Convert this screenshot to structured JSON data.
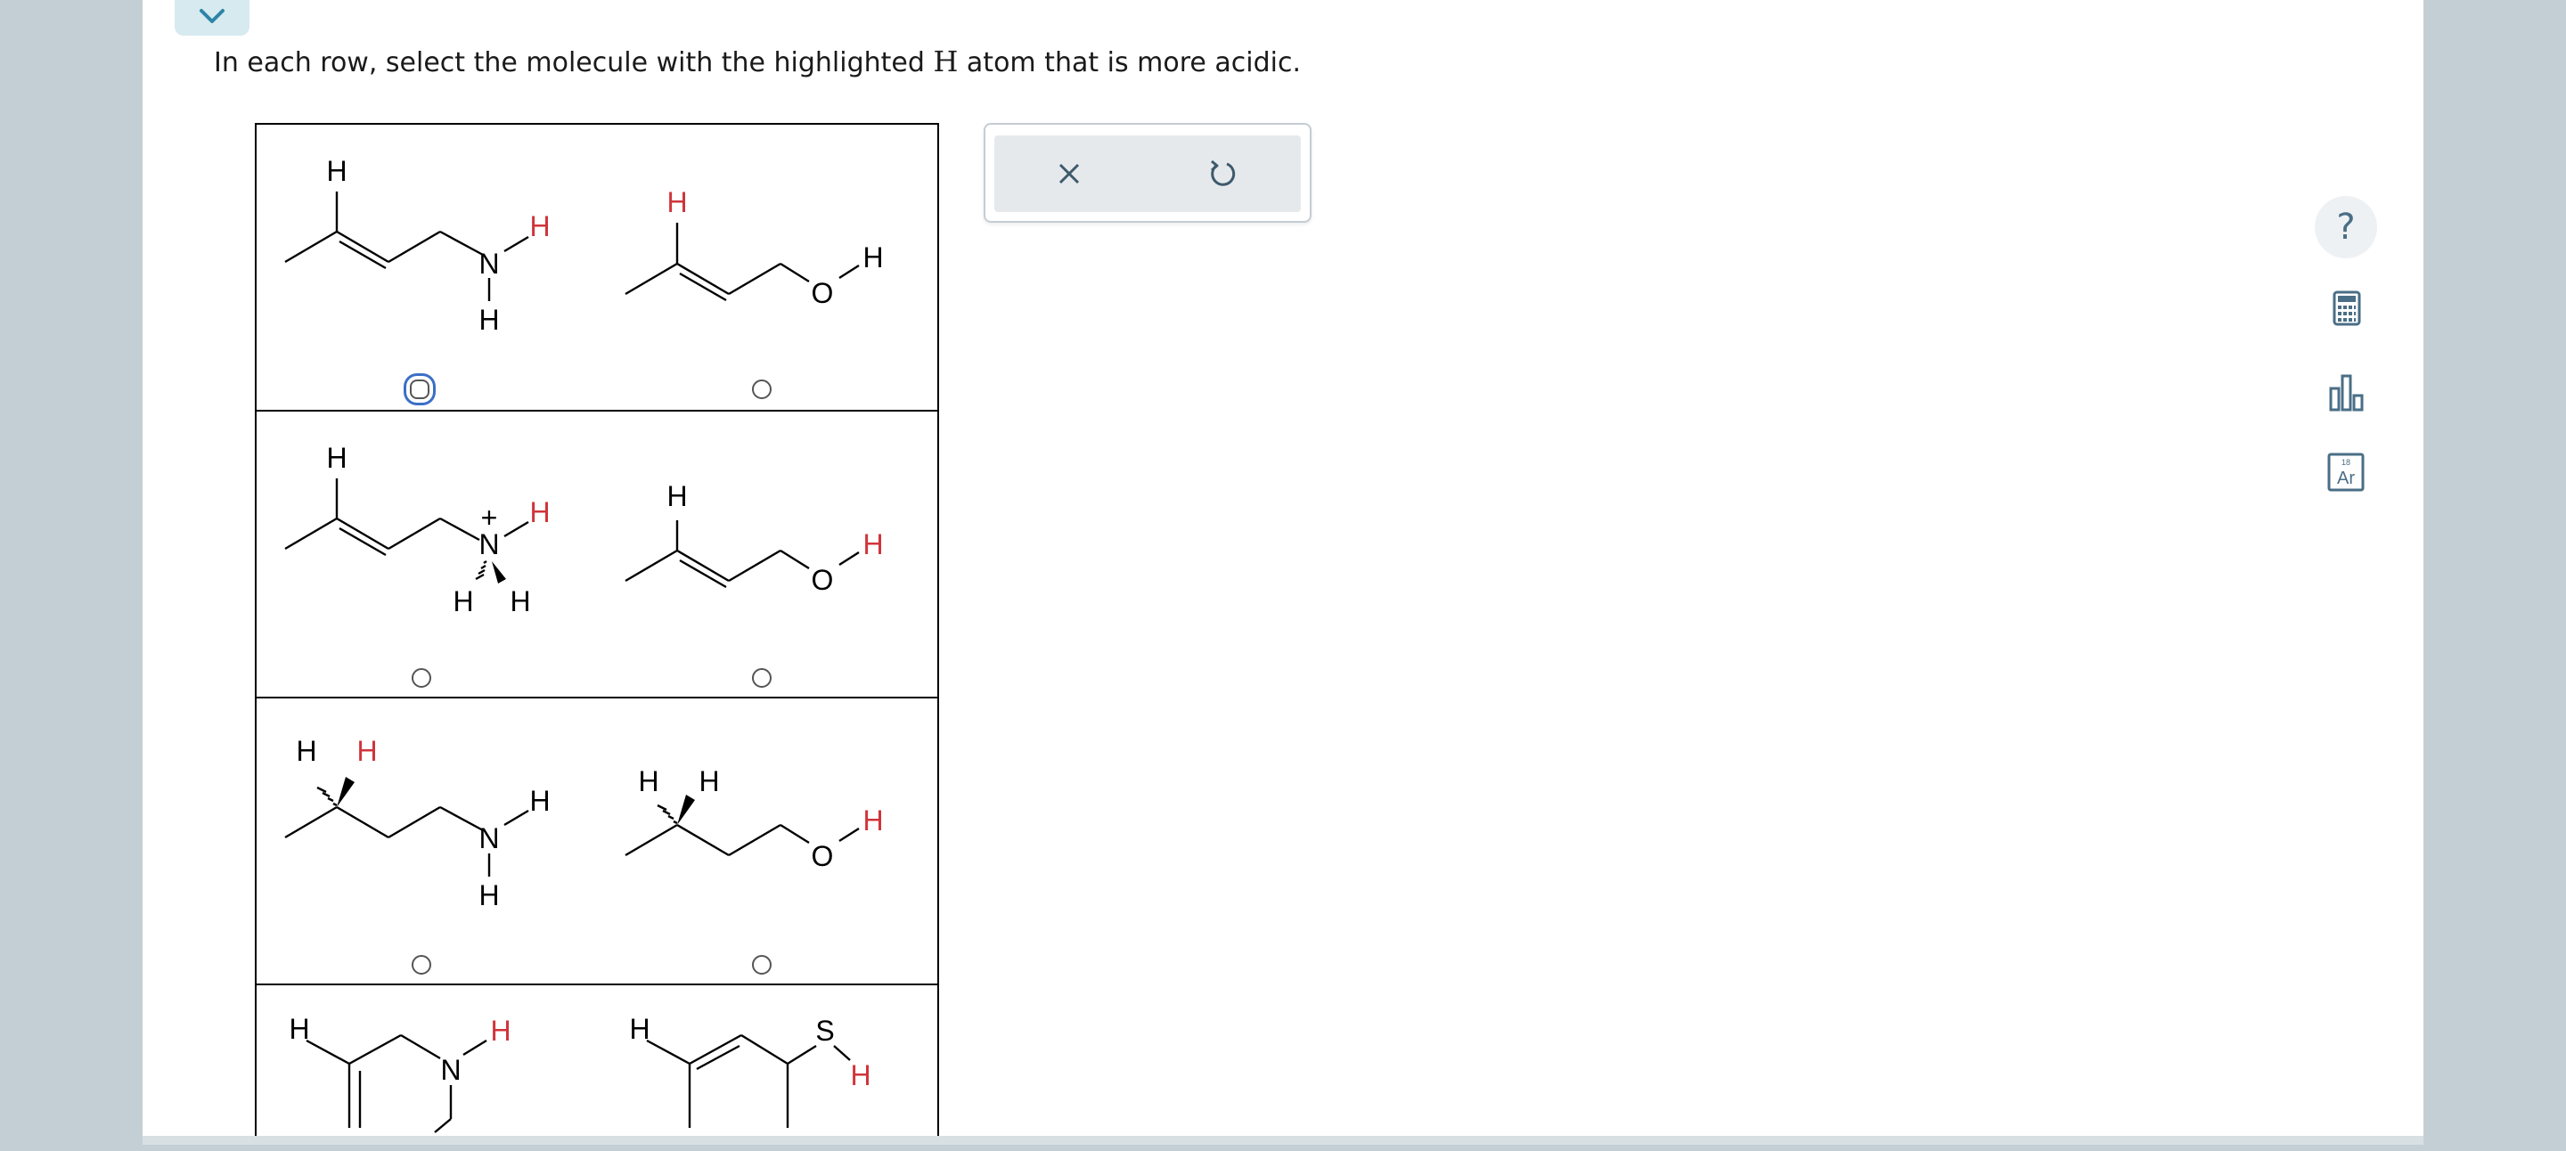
{
  "question": {
    "before": "In each row, select the molecule with the highlighted",
    "symbol": "H",
    "after": "atom that is more acidic."
  },
  "atoms": {
    "h": "H",
    "n": "N",
    "o": "O",
    "s": "S",
    "plus": "+"
  },
  "rows": [
    {
      "id": 1,
      "left_selected": false,
      "right_selected": false,
      "focused": "left"
    },
    {
      "id": 2,
      "left_selected": false,
      "right_selected": false
    },
    {
      "id": 3,
      "left_selected": false,
      "right_selected": false
    },
    {
      "id": 4,
      "left_selected": false,
      "right_selected": false
    }
  ],
  "actions": {
    "close_icon": "x-icon",
    "undo_icon": "undo-icon"
  },
  "tools": [
    "help-icon",
    "calculator-icon",
    "bar-chart-icon",
    "periodic-table-icon"
  ],
  "tool_labels": {
    "help": "?",
    "element_number": "18",
    "element_symbol": "Ar"
  },
  "colors": {
    "highlight": "#d0343a",
    "focus_ring": "#3b6fc6",
    "tool_icon": "#4a6e86",
    "accent_tab": "#2e84a6"
  }
}
